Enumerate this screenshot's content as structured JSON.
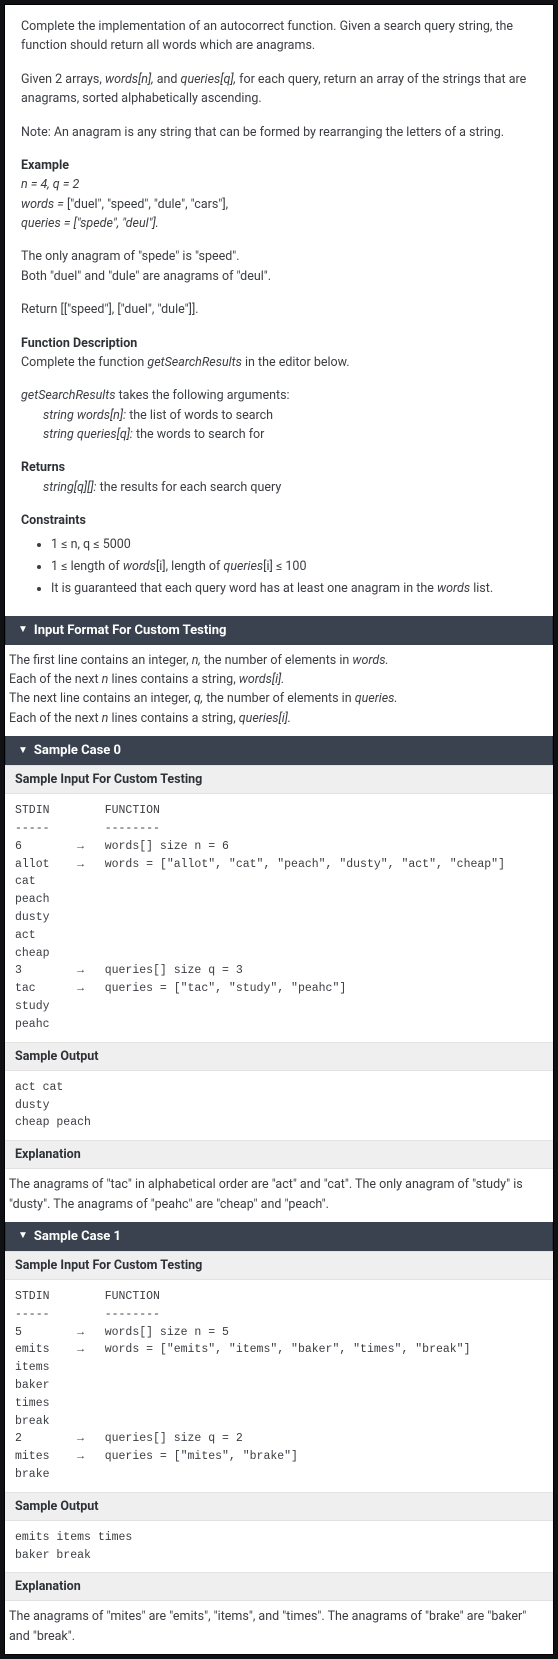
{
  "intro": {
    "p1a": "Complete the implementation of an ",
    "p1b": "autocorrect",
    "p1c": " function. Given a search query string, the function should return all words which are anagrams.",
    "p2a": "Given 2 arrays, ",
    "p2b": "words[n],",
    "p2c": " and ",
    "p2d": "queries[q],",
    "p2e": " for each query, return an array of the strings that are anagrams, sorted alphabetically ascending.",
    "p3": "Note: An anagram is any string that can be formed by rearranging the letters of a string."
  },
  "example": {
    "heading": "Example",
    "l1": "n = 4, q = 2",
    "l2a": "words =",
    "l2b": " [\"duel\", \"speed\", \"dule\", \"cars\"],",
    "l3": "queries = [\"spede\", \"deul\"].",
    "p1": "The only anagram of \"spede\" is \"speed\".",
    "p2": "Both \"duel\" and \"dule\" are anagrams of \"deul\".",
    "p3": "Return [[\"speed\"], [\"duel\", \"dule\"]]."
  },
  "funcdesc": {
    "heading": "Function Description",
    "l1a": "Complete the function ",
    "l1b": "getSearchResults",
    "l1c": " in the editor below.",
    "l2a": "getSearchResults",
    "l2b": " takes the following arguments:",
    "arg1a": "string words[n]:",
    "arg1b": " the list of words to search",
    "arg2a": "string queries[q]:",
    "arg2b": " the words to search for"
  },
  "returns": {
    "heading": "Returns",
    "l1a": "string[q][]:",
    "l1b": " the results for each search query"
  },
  "constraints": {
    "heading": "Constraints",
    "c1": "1 ≤ n, q ≤ 5000",
    "c2a": "1 ≤ length of ",
    "c2b": "words",
    "c2c": "[i], length of ",
    "c2d": "queries",
    "c2e": "[i] ≤ 100",
    "c3a": "It is guaranteed that each query word has at least one anagram in the ",
    "c3b": "words",
    "c3c": " list."
  },
  "inputformat": {
    "title": "Input Format For Custom Testing",
    "l1a": "The first line contains an integer, ",
    "l1b": "n,",
    "l1c": " the number of elements in ",
    "l1d": "words.",
    "l2a": "Each of the next ",
    "l2b": "n",
    "l2c": " lines contains a string, ",
    "l2d": "words[i].",
    "l3a": "The next line contains an integer, ",
    "l3b": "q,",
    "l3c": " the number of elements in ",
    "l3d": "queries.",
    "l4a": "Each of the next ",
    "l4b": "n",
    "l4c": " lines contains a string, ",
    "l4d": "queries[i]."
  },
  "sample0": {
    "title": "Sample Case 0",
    "inputHeading": "Sample Input For Custom Testing",
    "input": "STDIN        FUNCTION\n-----        --------\n6        →   words[] size n = 6\nallot    →   words = [\"allot\", \"cat\", \"peach\", \"dusty\", \"act\", \"cheap\"]\ncat\npeach\ndusty\nact\ncheap\n3        →   queries[] size q = 3\ntac      →   queries = [\"tac\", \"study\", \"peahc\"]\nstudy\npeahc",
    "outputHeading": "Sample Output",
    "output": "act cat\ndusty\ncheap peach",
    "explHeading": "Explanation",
    "explanation": "The anagrams of \"tac\" in alphabetical order are \"act\" and \"cat\". The only anagram of \"study\" is \"dusty\". The anagrams of \"peahc\" are \"cheap\" and \"peach\"."
  },
  "sample1": {
    "title": "Sample Case 1",
    "inputHeading": "Sample Input For Custom Testing",
    "input": "STDIN        FUNCTION\n-----        --------\n5        →   words[] size n = 5\nemits    →   words = [\"emits\", \"items\", \"baker\", \"times\", \"break\"]\nitems\nbaker\ntimes\nbreak\n2        →   queries[] size q = 2\nmites    →   queries = [\"mites\", \"brake\"]\nbrake",
    "outputHeading": "Sample Output",
    "output": "emits items times\nbaker break",
    "explHeading": "Explanation",
    "explanation": "The anagrams of \"mites\" are \"emits\", \"items\", and \"times\". The anagrams of \"brake\" are \"baker\" and \"break\"."
  }
}
